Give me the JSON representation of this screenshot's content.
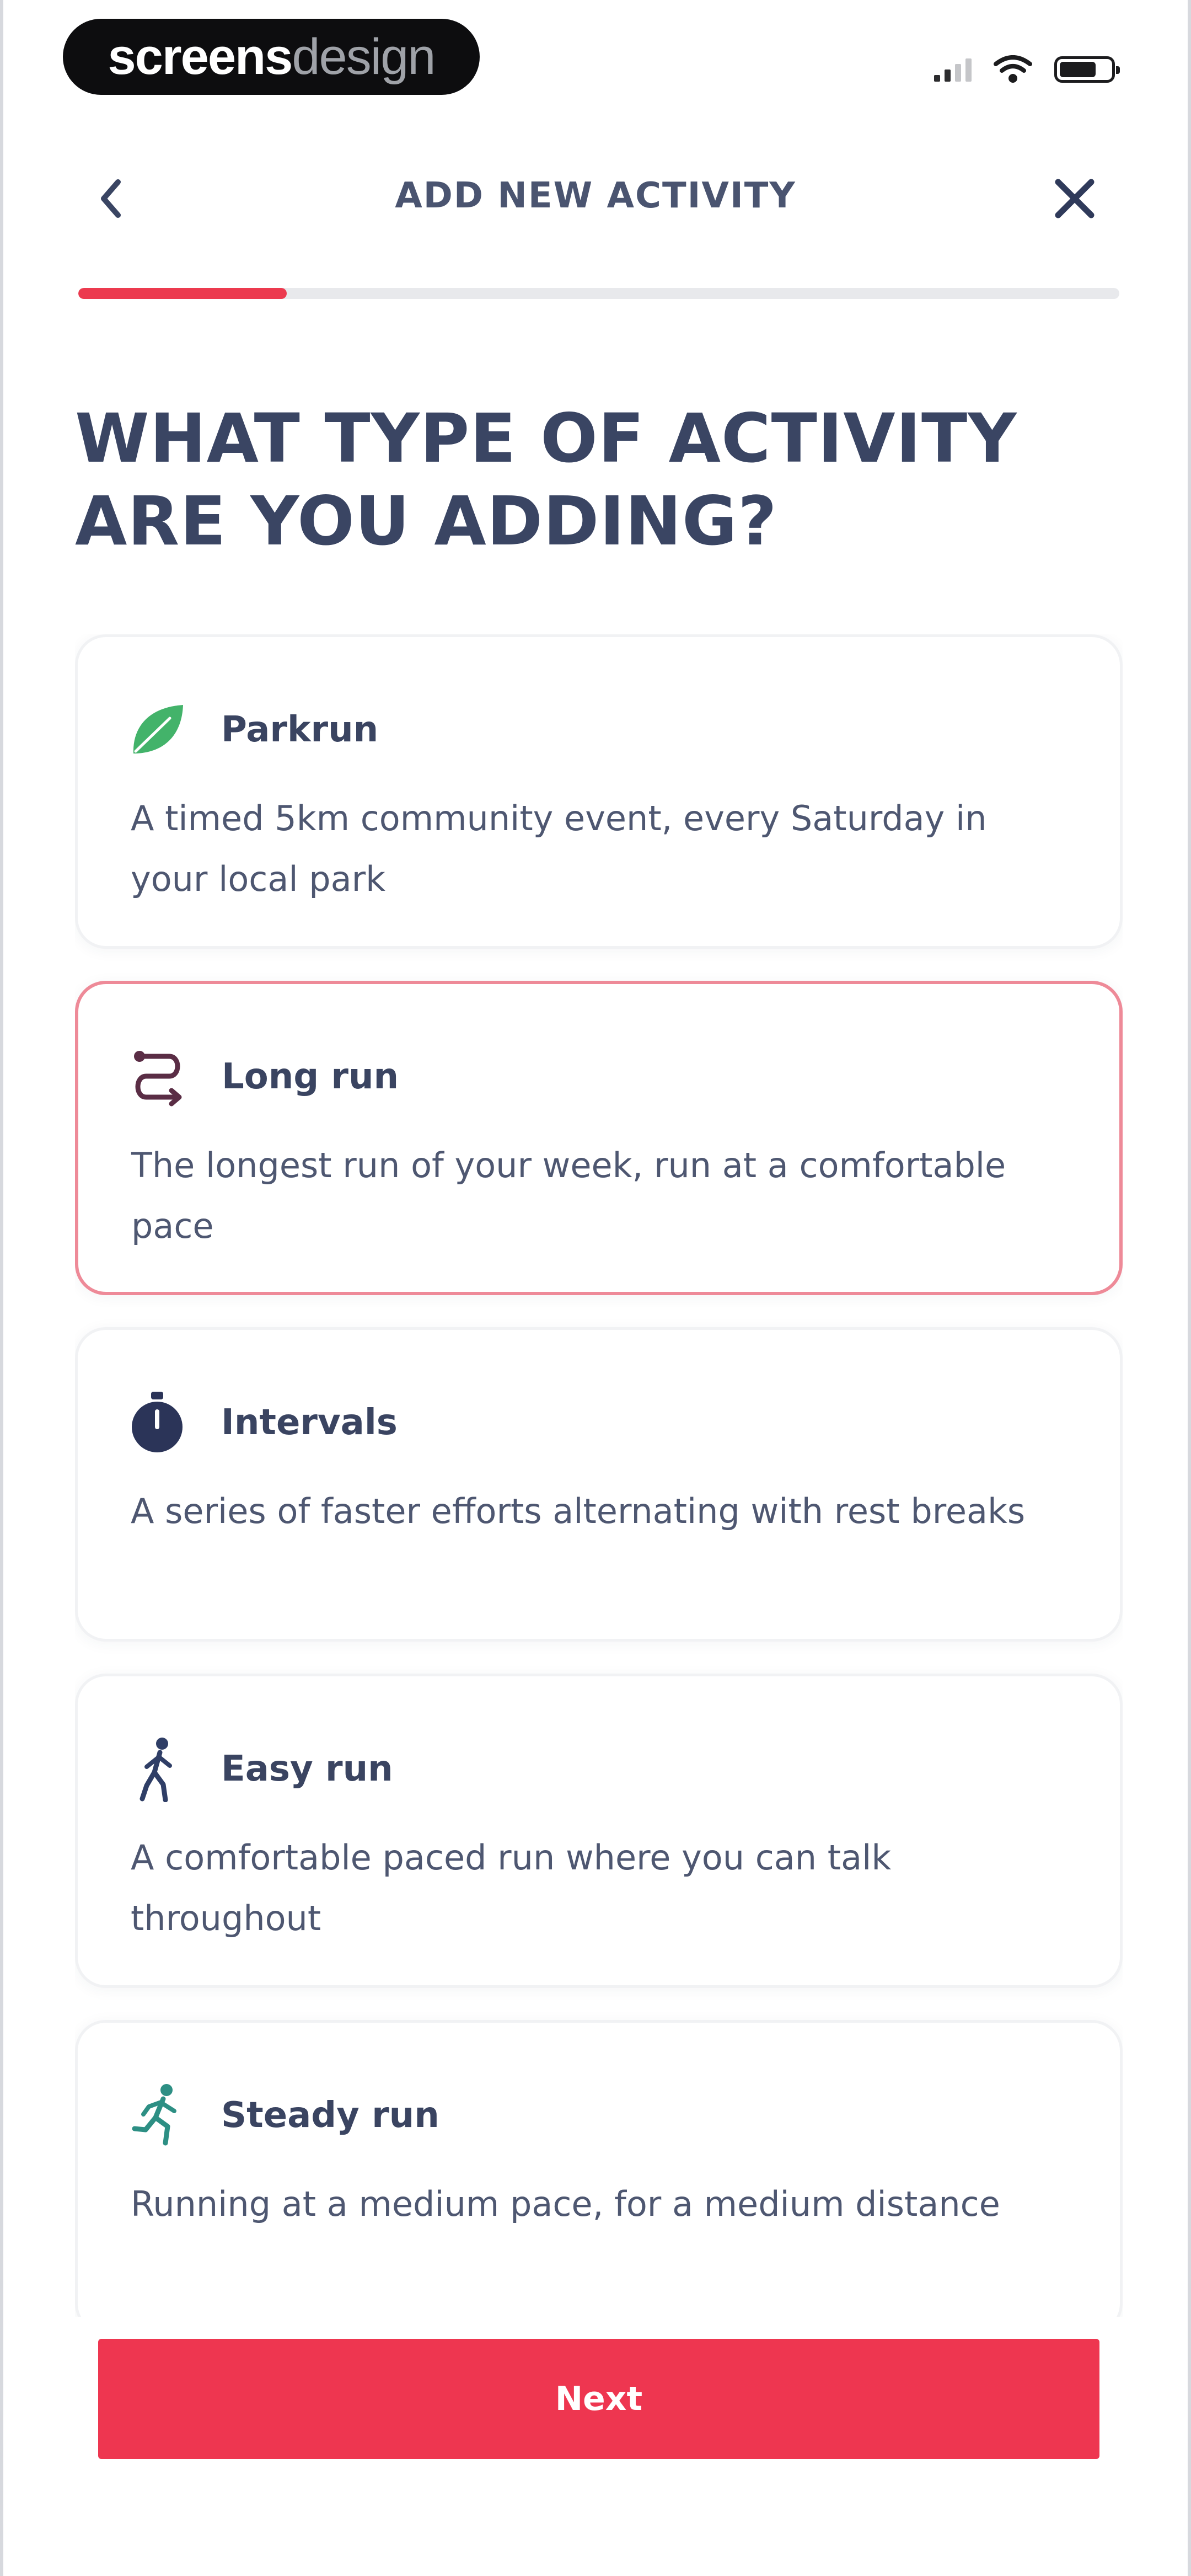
{
  "status_bar": {
    "brand_strong": "screens",
    "brand_light": "design",
    "icons": [
      "signal-icon",
      "wifi-icon",
      "battery-icon"
    ]
  },
  "header": {
    "title": "ADD NEW ACTIVITY",
    "back_icon": "chevron-left-icon",
    "close_icon": "close-icon"
  },
  "progress": {
    "value": 0.2
  },
  "question": "WHAT TYPE OF ACTIVITY ARE YOU ADDING?",
  "activities": [
    {
      "name": "Parkrun",
      "description": "A timed 5km community event, every Saturday in your local park",
      "icon": "leaf-icon",
      "selected": false
    },
    {
      "name": "Long run",
      "description": "The longest run of your week, run at a comfortable pace",
      "icon": "route-icon",
      "selected": true
    },
    {
      "name": "Intervals",
      "description": "A series of faster efforts alternating with rest breaks",
      "icon": "stopwatch-icon",
      "selected": false
    },
    {
      "name": "Easy run",
      "description": "A comfortable paced run where you can talk throughout",
      "icon": "walker-icon",
      "selected": false
    },
    {
      "name": "Steady run",
      "description": "Running at a medium pace, for a medium distance",
      "icon": "runner-icon",
      "selected": false
    }
  ],
  "next_label": "Next",
  "colors": {
    "accent": "#ee3650",
    "selected_border": "#ee8a98",
    "heading": "#3a4563",
    "leaf": "#43b36a",
    "route": "#5a2d45",
    "stopwatch": "#2b3458",
    "walker": "#2f3e66",
    "runner": "#2d8f84"
  }
}
